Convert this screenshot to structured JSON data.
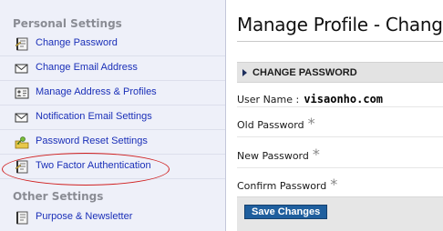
{
  "sidebar": {
    "sections": [
      {
        "heading": "Personal Settings",
        "items": [
          {
            "label": "Change Password",
            "icon": "notebook-icon"
          },
          {
            "label": "Change Email Address",
            "icon": "envelope-icon"
          },
          {
            "label": "Manage Address & Profiles",
            "icon": "address-card-icon"
          },
          {
            "label": "Notification Email Settings",
            "icon": "envelope-icon"
          },
          {
            "label": "Password Reset Settings",
            "icon": "key-folder-icon"
          },
          {
            "label": "Two Factor Authentication",
            "icon": "notebook-icon",
            "highlighted": true
          }
        ]
      },
      {
        "heading": "Other Settings",
        "items": [
          {
            "label": "Purpose & Newsletter",
            "icon": "notebook-icon"
          }
        ]
      }
    ]
  },
  "main": {
    "title": "Manage Profile - Change",
    "section_header": "CHANGE PASSWORD",
    "fields": {
      "username_label": "User Name :",
      "username_value": "visaonho.com",
      "old_password_label": "Old Password",
      "new_password_label": "New Password",
      "confirm_password_label": "Confirm Password",
      "required_marker": "*"
    },
    "save_label": "Save Changes"
  },
  "colors": {
    "sidebar_bg": "#eef0f9",
    "link": "#1a2fb8",
    "button_bg": "#1f5f9e",
    "highlight_ring": "#d02020"
  }
}
